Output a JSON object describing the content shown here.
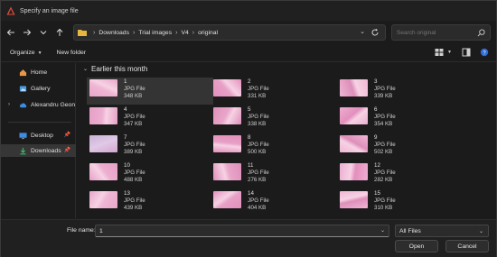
{
  "window": {
    "title": "Specify an image file",
    "accent": "#e04b3a"
  },
  "nav": {
    "back_icon": "arrow-left-icon",
    "forward_icon": "arrow-right-icon",
    "recent_icon": "chevron-down-icon",
    "up_icon": "arrow-up-icon"
  },
  "address": {
    "crumbs": [
      "Downloads",
      "Trial images",
      "V4",
      "original"
    ],
    "refresh_icon": "refresh-icon"
  },
  "search": {
    "placeholder": "Search original"
  },
  "toolbar": {
    "organize_label": "Organize",
    "new_folder_label": "New folder"
  },
  "sidebar": {
    "items": [
      {
        "label": "Home",
        "icon": "home-icon"
      },
      {
        "label": "Gallery",
        "icon": "gallery-icon"
      },
      {
        "label": "Alexandru Geon",
        "icon": "cloud-icon"
      },
      {
        "label": "Desktop",
        "icon": "desktop-icon"
      },
      {
        "label": "Downloads",
        "icon": "download-icon"
      }
    ]
  },
  "main": {
    "group_label": "Earlier this month",
    "files": [
      {
        "name": "1",
        "type": "JPG File",
        "size": "348 KB"
      },
      {
        "name": "2",
        "type": "JPG File",
        "size": "331 KB"
      },
      {
        "name": "3",
        "type": "JPG File",
        "size": "339 KB"
      },
      {
        "name": "4",
        "type": "JPG File",
        "size": "347 KB"
      },
      {
        "name": "5",
        "type": "JPG File",
        "size": "338 KB"
      },
      {
        "name": "6",
        "type": "JPG File",
        "size": "354 KB"
      },
      {
        "name": "7",
        "type": "JPG File",
        "size": "389 KB"
      },
      {
        "name": "8",
        "type": "JPG File",
        "size": "500 KB"
      },
      {
        "name": "9",
        "type": "JPG File",
        "size": "502 KB"
      },
      {
        "name": "10",
        "type": "JPG File",
        "size": "488 KB"
      },
      {
        "name": "11",
        "type": "JPG File",
        "size": "276 KB"
      },
      {
        "name": "12",
        "type": "JPG File",
        "size": "282 KB"
      },
      {
        "name": "13",
        "type": "JPG File",
        "size": "439 KB"
      },
      {
        "name": "14",
        "type": "JPG File",
        "size": "404 KB"
      },
      {
        "name": "15",
        "type": "JPG File",
        "size": "310 KB"
      }
    ]
  },
  "footer": {
    "filename_label": "File name:",
    "filename_value": "1",
    "filetype_value": "All Files",
    "open_label": "Open",
    "cancel_label": "Cancel"
  }
}
